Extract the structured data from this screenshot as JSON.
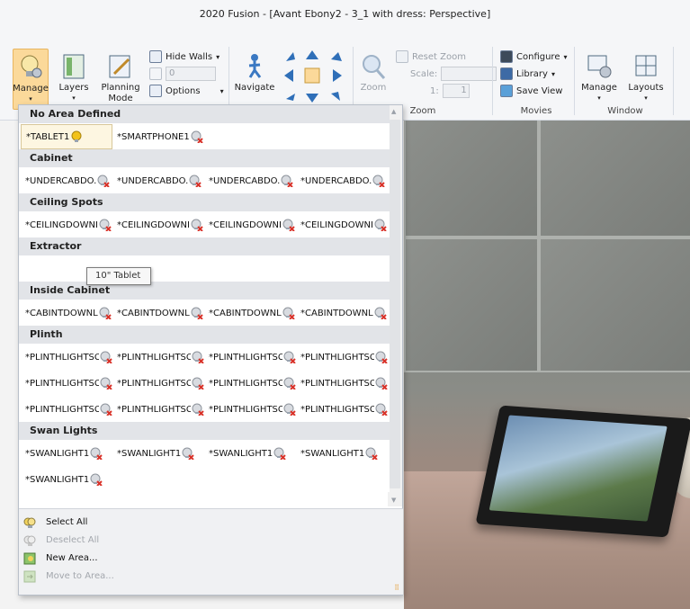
{
  "window": {
    "title": "2020 Fusion - [Avant Ebony2 - 3_1 with dress: Perspective]"
  },
  "ribbon": {
    "manage_label": "Manage",
    "layers_label": "Layers",
    "planning_mode_label": "Planning\nMode",
    "hide_walls_label": "Hide Walls",
    "wall_height_value": "0",
    "options_label": "Options",
    "navigate_label": "Navigate",
    "zoom_label": "Zoom",
    "reset_zoom_label": "Reset Zoom",
    "scale_label": "Scale:",
    "scale_ratio_label": "1:",
    "scale_ratio_value": "1",
    "configure_label": "Configure",
    "library_label": "Library",
    "save_view_label": "Save View",
    "window_manage_label": "Manage",
    "layouts_label": "Layouts",
    "groups": {
      "zoom": "Zoom",
      "movies": "Movies",
      "window": "Window"
    }
  },
  "panel": {
    "sections": [
      {
        "title": "No Area Defined",
        "rows": [
          [
            "*TABLET1",
            "*SMARTPHONE1"
          ]
        ]
      },
      {
        "title": "Cabinet",
        "rows": [
          [
            "*UNDERCABDO.",
            "*UNDERCABDO.",
            "*UNDERCABDO.",
            "*UNDERCABDO."
          ]
        ]
      },
      {
        "title": "Ceiling Spots",
        "rows": [
          [
            "*CEILINGDOWNI",
            "*CEILINGDOWNI",
            "*CEILINGDOWNI",
            "*CEILINGDOWNI"
          ]
        ]
      },
      {
        "title": "Extractor",
        "rows": [
          []
        ]
      },
      {
        "title": "Inside Cabinet",
        "rows": [
          [
            "*CABINTDOWNL",
            "*CABINTDOWNL",
            "*CABINTDOWNL",
            "*CABINTDOWNL"
          ]
        ]
      },
      {
        "title": "Plinth",
        "rows": [
          [
            "*PLINTHLIGHTSC",
            "*PLINTHLIGHTSC",
            "*PLINTHLIGHTSC",
            "*PLINTHLIGHTSC"
          ],
          [
            "*PLINTHLIGHTSC",
            "*PLINTHLIGHTSC",
            "*PLINTHLIGHTSC",
            "*PLINTHLIGHTSC"
          ],
          [
            "*PLINTHLIGHTSC",
            "*PLINTHLIGHTSC",
            "*PLINTHLIGHTSC",
            "*PLINTHLIGHTSC"
          ]
        ]
      },
      {
        "title": "Swan Lights",
        "rows": [
          [
            "*SWANLIGHT1",
            "*SWANLIGHT1",
            "*SWANLIGHT1",
            "*SWANLIGHT1"
          ],
          [
            "*SWANLIGHT1"
          ]
        ]
      }
    ],
    "tooltip": "10\" Tablet",
    "menu": [
      {
        "label": "Select All",
        "enabled": true
      },
      {
        "label": "Deselect All",
        "enabled": false
      },
      {
        "label": "New Area...",
        "enabled": true
      },
      {
        "label": "Move to Area...",
        "enabled": false
      }
    ]
  },
  "colors": {
    "section_header": "#e2e4e8",
    "manage_highlight": "#fbd99a",
    "light_off_x": "#d9342b",
    "light_on": "#f2c21b"
  }
}
